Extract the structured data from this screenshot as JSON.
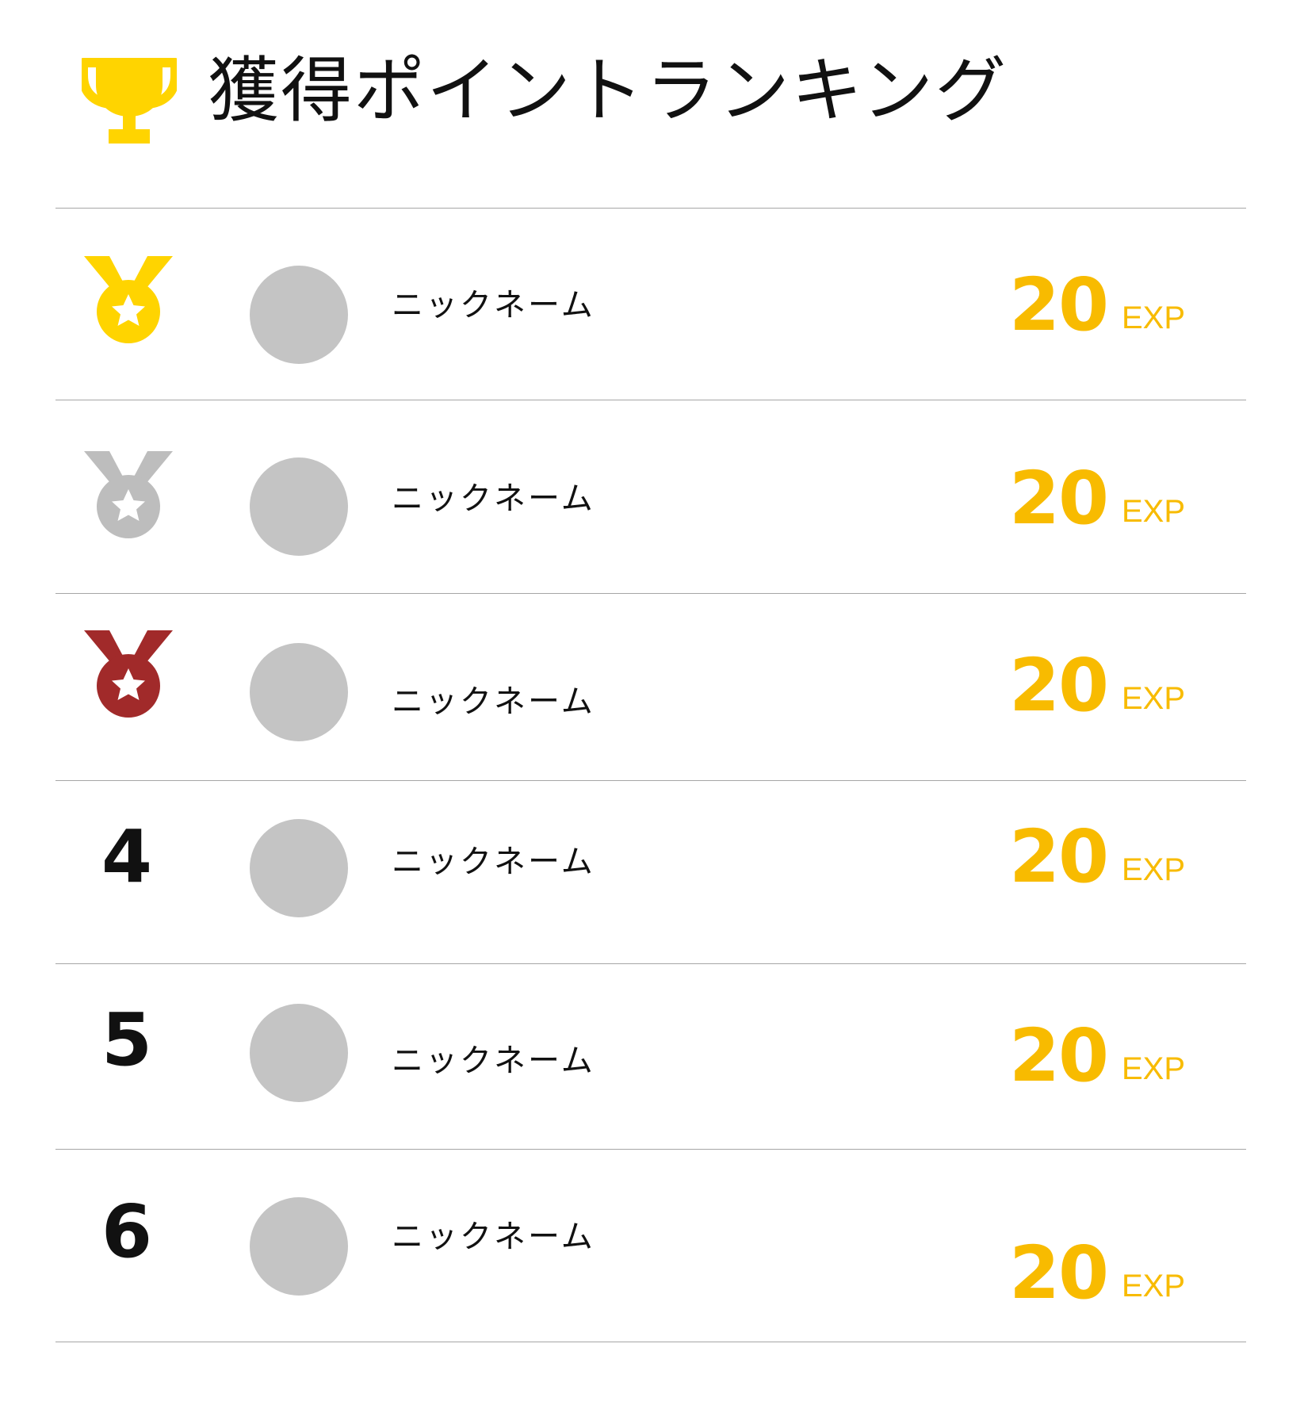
{
  "header": {
    "icon": "trophy-icon",
    "title": "獲得ポイントランキング"
  },
  "colors": {
    "accent": "#f8bb00",
    "gold": "#ffd400",
    "silver": "#bdbdbd",
    "bronze": "#a12a2a",
    "avatar": "#c4c4c4",
    "divider": "#a6a6a6"
  },
  "ranking": [
    {
      "rank": "1",
      "medal_icon": "gold-medal-icon",
      "nickname": "ニックネーム",
      "points": "20",
      "unit": "EXP"
    },
    {
      "rank": "2",
      "medal_icon": "silver-medal-icon",
      "nickname": "ニックネーム",
      "points": "20",
      "unit": "EXP"
    },
    {
      "rank": "3",
      "medal_icon": "bronze-medal-icon",
      "nickname": "ニックネーム",
      "points": "20",
      "unit": "EXP"
    },
    {
      "rank": "4",
      "nickname": "ニックネーム",
      "points": "20",
      "unit": "EXP"
    },
    {
      "rank": "5",
      "nickname": "ニックネーム",
      "points": "20",
      "unit": "EXP"
    },
    {
      "rank": "6",
      "nickname": "ニックネーム",
      "points": "20",
      "unit": "EXP"
    }
  ]
}
